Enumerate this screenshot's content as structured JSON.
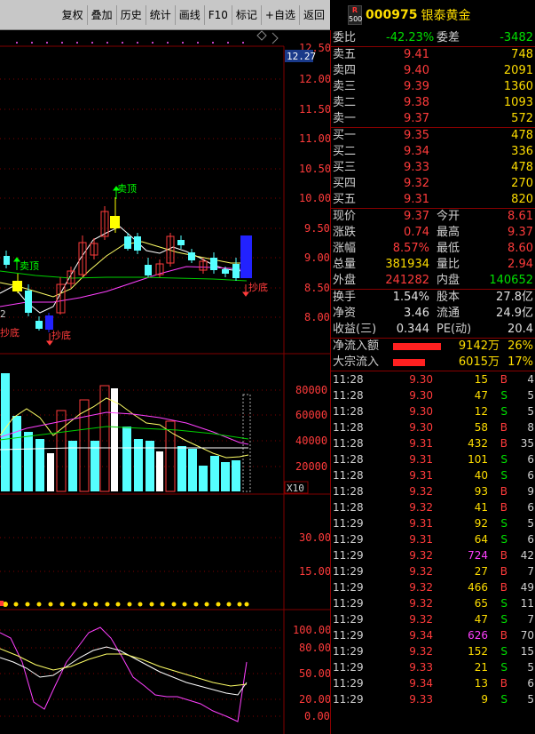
{
  "toolbar": {
    "buttons": [
      "复权",
      "叠加",
      "历史",
      "统计",
      "画线",
      "F10",
      "标记",
      "+自选",
      "返回"
    ]
  },
  "header": {
    "badge_top": "R",
    "badge_bottom": "500",
    "code": "000975",
    "name": "银泰黄金"
  },
  "kline": {
    "price_axis": [
      "12.50",
      "12.00",
      "11.50",
      "11.00",
      "10.50",
      "10.00",
      "9.50",
      "9.00",
      "8.50",
      "8.00"
    ],
    "current_price_tag": "12.27",
    "annotations": [
      "卖顶",
      "卖顶",
      "抄底",
      "抄底",
      "抄底"
    ],
    "left_edge_label": "2"
  },
  "volume": {
    "axis": [
      "80000",
      "60000",
      "40000",
      "20000"
    ],
    "unit": "X10"
  },
  "indicator1": {
    "axis": [
      "30.00",
      "15.00"
    ]
  },
  "indicator2": {
    "axis": [
      "100.00",
      "80.00",
      "50.00",
      "20.00",
      "0.00"
    ]
  },
  "quote": {
    "weibi_label": "委比",
    "weibi_value": "-42.23%",
    "weicha_label": "委差",
    "weicha_value": "-3482",
    "sell": [
      {
        "label": "卖五",
        "price": "9.41",
        "vol": "748"
      },
      {
        "label": "卖四",
        "price": "9.40",
        "vol": "2091"
      },
      {
        "label": "卖三",
        "price": "9.39",
        "vol": "1360"
      },
      {
        "label": "卖二",
        "price": "9.38",
        "vol": "1093"
      },
      {
        "label": "卖一",
        "price": "9.37",
        "vol": "572"
      }
    ],
    "buy": [
      {
        "label": "买一",
        "price": "9.35",
        "vol": "478"
      },
      {
        "label": "买二",
        "price": "9.34",
        "vol": "336"
      },
      {
        "label": "买三",
        "price": "9.33",
        "vol": "478"
      },
      {
        "label": "买四",
        "price": "9.32",
        "vol": "270"
      },
      {
        "label": "买五",
        "price": "9.31",
        "vol": "820"
      }
    ],
    "stats": [
      {
        "l1": "现价",
        "v1": "9.37",
        "l2": "今开",
        "v2": "8.61"
      },
      {
        "l1": "涨跌",
        "v1": "0.74",
        "l2": "最高",
        "v2": "9.37"
      },
      {
        "l1": "涨幅",
        "v1": "8.57%",
        "l2": "最低",
        "v2": "8.60"
      },
      {
        "l1": "总量",
        "v1": "381934",
        "l2": "量比",
        "v2": "2.94"
      },
      {
        "l1": "外盘",
        "v1": "241282",
        "l2": "内盘",
        "v2": "140652"
      }
    ],
    "fund": [
      {
        "l1": "换手",
        "v1": "1.54%",
        "l2": "股本",
        "v2": "27.8亿"
      },
      {
        "l1": "净资",
        "v1": "3.46",
        "l2": "流通",
        "v2": "24.9亿"
      },
      {
        "l1": "收益(三)",
        "v1": "0.344",
        "l2": "PE(动)",
        "v2": "20.4"
      }
    ],
    "flow": [
      {
        "label": "净流入额",
        "amount": "9142万",
        "pct": "26%"
      },
      {
        "label": "大宗流入",
        "amount": "6015万",
        "pct": "17%"
      }
    ]
  },
  "ticks": [
    {
      "t": "11:28",
      "p": "9.30",
      "v": "15",
      "bs": "B",
      "n": "4"
    },
    {
      "t": "11:28",
      "p": "9.30",
      "v": "47",
      "bs": "S",
      "n": "5"
    },
    {
      "t": "11:28",
      "p": "9.30",
      "v": "12",
      "bs": "S",
      "n": "5"
    },
    {
      "t": "11:28",
      "p": "9.30",
      "v": "58",
      "bs": "B",
      "n": "8"
    },
    {
      "t": "11:28",
      "p": "9.31",
      "v": "432",
      "bs": "B",
      "n": "35"
    },
    {
      "t": "11:28",
      "p": "9.31",
      "v": "101",
      "bs": "S",
      "n": "6"
    },
    {
      "t": "11:28",
      "p": "9.31",
      "v": "40",
      "bs": "S",
      "n": "6"
    },
    {
      "t": "11:28",
      "p": "9.32",
      "v": "93",
      "bs": "B",
      "n": "9"
    },
    {
      "t": "11:28",
      "p": "9.32",
      "v": "41",
      "bs": "B",
      "n": "6"
    },
    {
      "t": "11:29",
      "p": "9.31",
      "v": "92",
      "bs": "S",
      "n": "5"
    },
    {
      "t": "11:29",
      "p": "9.31",
      "v": "64",
      "bs": "S",
      "n": "6"
    },
    {
      "t": "11:29",
      "p": "9.32",
      "v": "724",
      "bs": "B",
      "n": "42"
    },
    {
      "t": "11:29",
      "p": "9.32",
      "v": "27",
      "bs": "B",
      "n": "7"
    },
    {
      "t": "11:29",
      "p": "9.32",
      "v": "466",
      "bs": "B",
      "n": "49"
    },
    {
      "t": "11:29",
      "p": "9.32",
      "v": "65",
      "bs": "S",
      "n": "11"
    },
    {
      "t": "11:29",
      "p": "9.32",
      "v": "47",
      "bs": "S",
      "n": "7"
    },
    {
      "t": "11:29",
      "p": "9.34",
      "v": "626",
      "bs": "B",
      "n": "70"
    },
    {
      "t": "11:29",
      "p": "9.32",
      "v": "152",
      "bs": "S",
      "n": "15"
    },
    {
      "t": "11:29",
      "p": "9.33",
      "v": "21",
      "bs": "S",
      "n": "5"
    },
    {
      "t": "11:29",
      "p": "9.34",
      "v": "13",
      "bs": "B",
      "n": "6"
    },
    {
      "t": "11:29",
      "p": "9.33",
      "v": "9",
      "bs": "S",
      "n": "5"
    }
  ],
  "colors": {
    "up": "#ff3b3b",
    "down": "#00e000",
    "accent": "#ffde00",
    "vol_down": "#5ff"
  }
}
